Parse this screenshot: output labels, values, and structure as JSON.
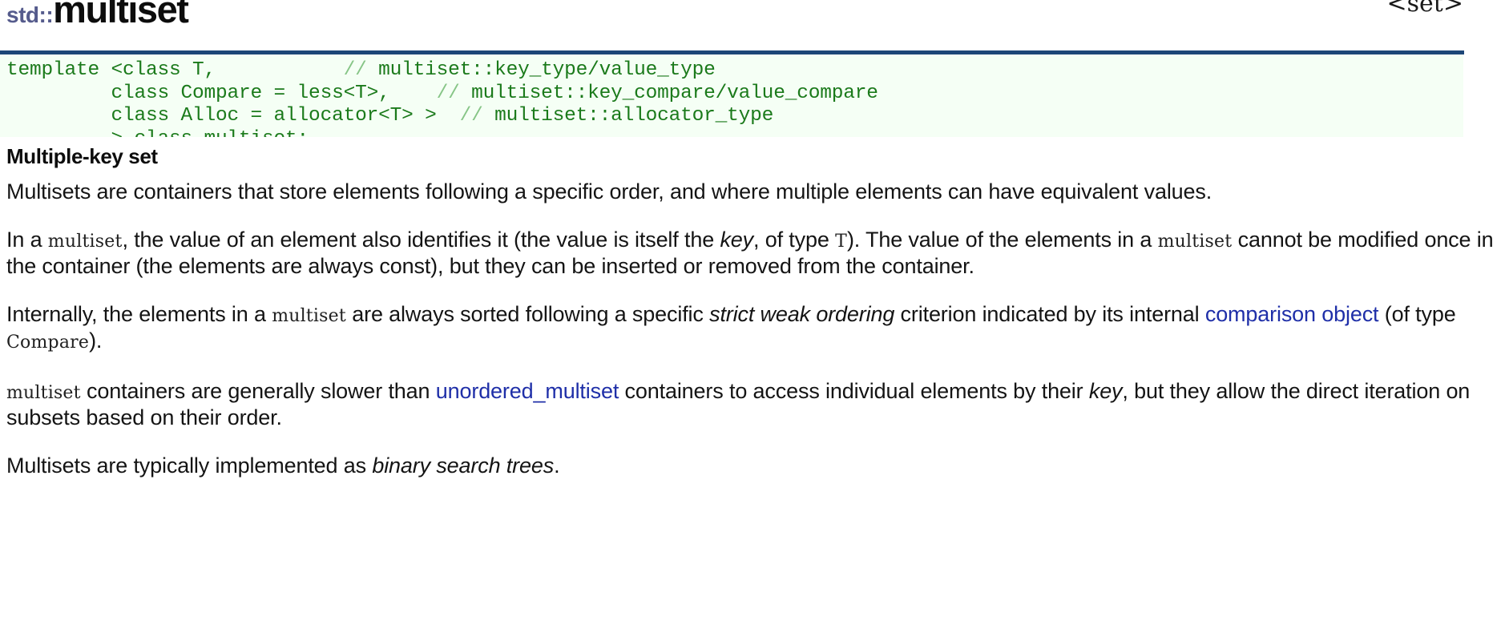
{
  "header": {
    "namespace": "std::",
    "name": "multiset",
    "include": "<set>",
    "rule_color": "#1d4677",
    "namespace_color": "#555b8c"
  },
  "code": {
    "background": "#f5fff5",
    "text_color": "#1b7a1b",
    "comment_slash_color": "#86c586",
    "lines": [
      {
        "code": "template <class T,",
        "comment": "// multiset::key_type/value_type"
      },
      {
        "code": "         class Compare = less<T>,",
        "comment": "// multiset::key_compare/value_compare"
      },
      {
        "code": "         class Alloc = allocator<T> >",
        "comment": "// multiset::allocator_type"
      },
      {
        "code": "         > class multiset;",
        "comment": ""
      }
    ]
  },
  "subheading": "Multiple-key set",
  "paragraphs": {
    "p1": {
      "t1": "Multisets are containers that store elements following a specific order, and where multiple elements can have equivalent values."
    },
    "p2": {
      "t1": "In a ",
      "c1": "multiset",
      "t2": ", the value of an element also identifies it (the value is itself the ",
      "i1": "key",
      "t3": ", of type ",
      "c2": "T",
      "t4": "). The value of the elements in a ",
      "c3": "multiset",
      "t5": " cannot be modified once in the container (the elements are always const), but they can be inserted or removed from the container."
    },
    "p3": {
      "t1": "Internally, the elements in a ",
      "c1": "multiset",
      "t2": " are always sorted following a specific ",
      "i1": "strict weak ordering",
      "t3": " criterion indicated by its internal ",
      "link1": "comparison object",
      "t4": " (of type ",
      "c2": "Compare",
      "t5": ")."
    },
    "p4": {
      "c1": "multiset",
      "t1": " containers are generally slower than ",
      "link1": "unordered_multiset",
      "t2": " containers to access individual elements by their ",
      "i1": "key",
      "t3": ", but they allow the direct iteration on subsets based on their order."
    },
    "p5": {
      "t1": "Multisets are typically implemented as ",
      "i1": "binary search trees",
      "t2": "."
    }
  },
  "link_color": "#1f2fa8"
}
